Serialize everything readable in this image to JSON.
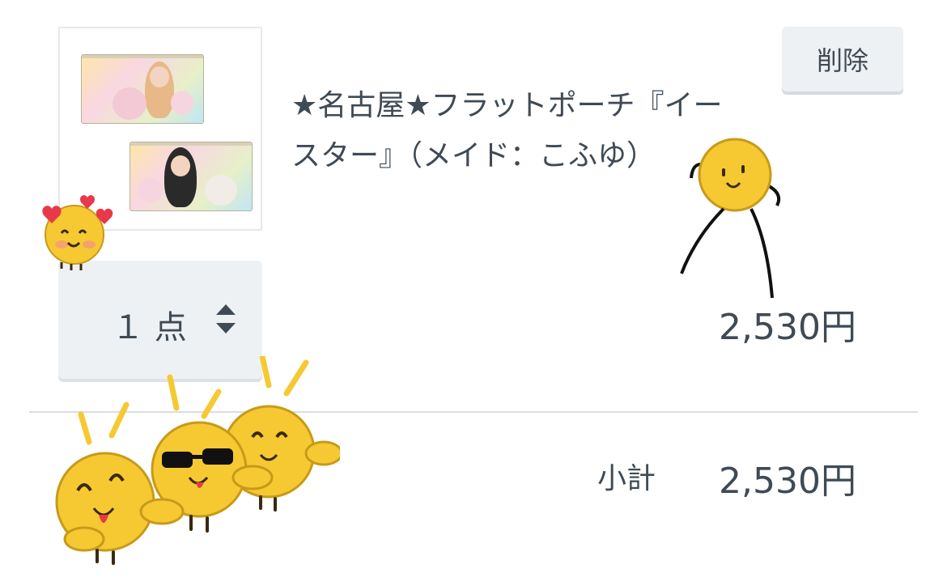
{
  "cart_item": {
    "product_name_line1": "★名古屋★フラットポーチ『イー",
    "product_name_line2": "スター』（メイド：こふゆ）",
    "delete_label": "削除",
    "quantity_label": "１ 点",
    "price": "2,530円",
    "thumbnail_icon": "product-pouch-photo"
  },
  "summary": {
    "subtotal_label": "小計",
    "subtotal_value": "2,530円"
  },
  "stickers": [
    "heart-eyes-chick-sticker",
    "dancing-chick-sticker",
    "three-chicks-sticker"
  ],
  "colors": {
    "text": "#3f4a55",
    "button_bg": "#eef1f3",
    "divider": "#d9dde1",
    "sticker_yellow": "#f6c933",
    "sticker_outline": "#5a3d10"
  }
}
